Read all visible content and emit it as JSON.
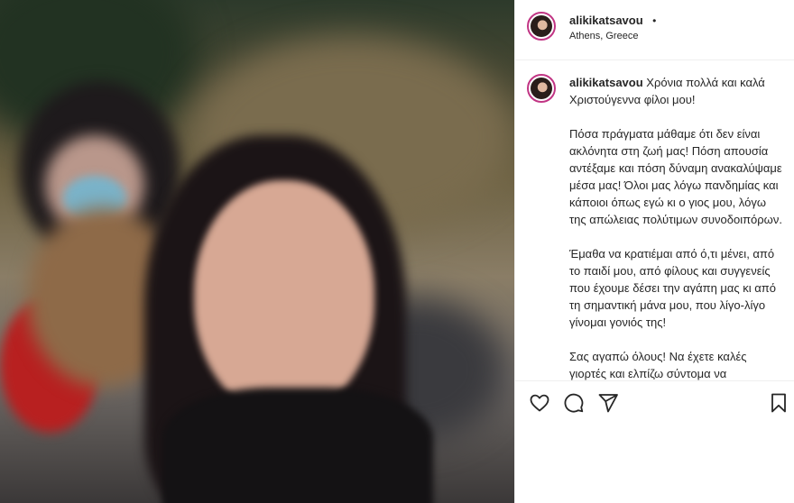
{
  "post": {
    "username": "alikikatsavou",
    "dot": "•",
    "location": "Athens, Greece"
  },
  "caption": {
    "username": "alikikatsavou",
    "paragraphs": [
      "Χρόνια πολλά και καλά Χριστούγεννα φίλοι μου!",
      "Πόσα πράγματα μάθαμε ότι δεν είναι ακλόνητα στη ζωή μας! Πόση απουσία αντέξαμε και πόση δύναμη ανακαλύψαμε μέσα μας! Όλοι μας λόγω πανδημίας και κάποιοι όπως εγώ κι ο γιος μου, λόγω της απώλειας πολύτιμων συνοδοιπόρων.",
      "Έμαθα να κρατιέμαι από ό,τι μένει, από το παιδί μου, από φίλους και συγγενείς που έχουμε δέσει την αγάπη μας κι από τη σημαντική μάνα μου, που λίγο-λίγο γίνομαι γονιός της!",
      "Σας αγαπώ όλους! Να έχετε καλές γιορτές και ελπίζω σύντομα να"
    ]
  },
  "icons": [
    "heart-icon",
    "comment-icon",
    "share-icon",
    "bookmark-icon"
  ]
}
